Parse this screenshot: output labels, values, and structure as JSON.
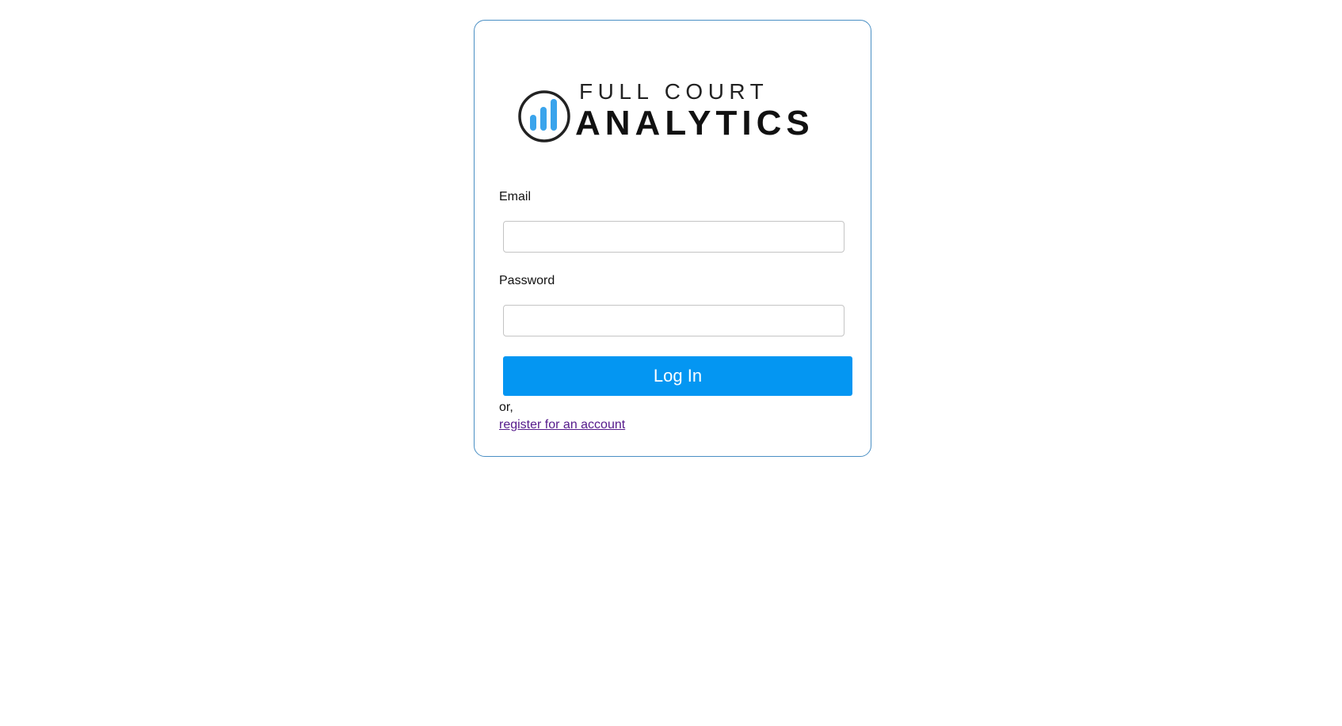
{
  "logo": {
    "line1": "FULL COURT",
    "line2": "ANALYTICS",
    "icon": "bar-chart-circle-icon",
    "bar_color": "#3aa4ec",
    "ring_color": "#222222"
  },
  "form": {
    "email_label": "Email",
    "email_value": "",
    "password_label": "Password",
    "password_value": "",
    "login_label": "Log In",
    "or_text": "or,",
    "register_label": "register for an account"
  },
  "colors": {
    "card_border": "#4a8fc4",
    "button_bg": "#0496f2",
    "link_visited": "#551a8b"
  }
}
